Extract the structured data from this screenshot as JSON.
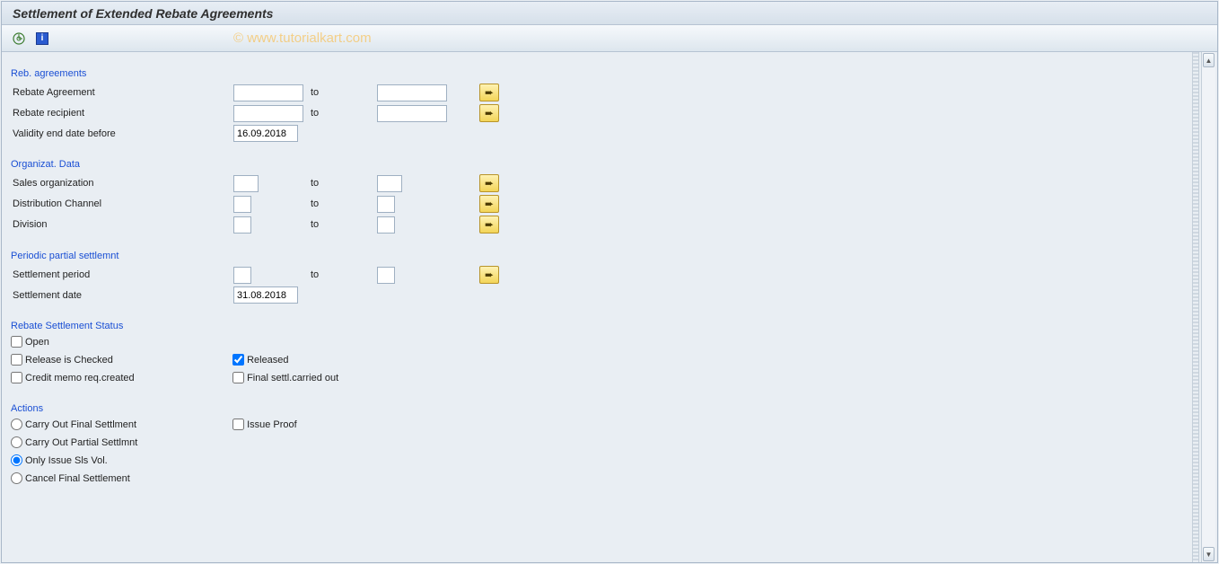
{
  "page": {
    "title": "Settlement of Extended Rebate Agreements"
  },
  "watermark": "© www.tutorialkart.com",
  "sections": {
    "reb": "Reb. agreements",
    "org": "Organizat. Data",
    "pps": "Periodic partial settlemnt",
    "status": "Rebate Settlement Status",
    "actions": "Actions"
  },
  "labels": {
    "rebate_agreement": "Rebate Agreement",
    "rebate_recipient": "Rebate recipient",
    "validity_end_before": "Validity end date before",
    "sales_org": "Sales organization",
    "dist_channel": "Distribution Channel",
    "division": "Division",
    "settlement_period": "Settlement period",
    "settlement_date": "Settlement date",
    "to": "to",
    "open": "Open",
    "release_checked": "Release is Checked",
    "released": "Released",
    "credit_memo": "Credit memo req.created",
    "final_carried_out": "Final settl.carried out",
    "final_settlement": "Carry Out Final Settlment",
    "issue_proof": "Issue Proof",
    "partial_settlement": "Carry Out Partial Settlmnt",
    "only_issue_sls": "Only Issue Sls Vol.",
    "cancel_final": "Cancel Final Settlement"
  },
  "values": {
    "validity_end_before": "16.09.2018",
    "settlement_date": "31.08.2018"
  },
  "status": {
    "open": false,
    "release_checked": false,
    "released": true,
    "credit_memo": false,
    "final_carried_out": false,
    "issue_proof": false
  },
  "action_selected": "only_issue_sls"
}
